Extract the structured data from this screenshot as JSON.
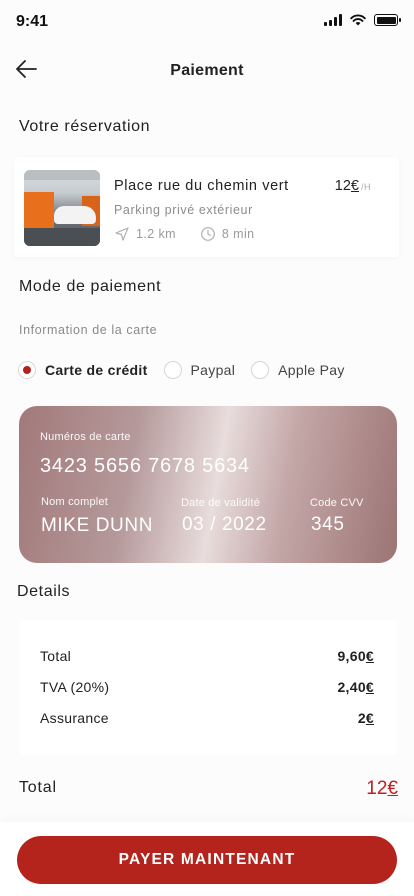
{
  "status": {
    "time": "9:41"
  },
  "header": {
    "title": "Paiement",
    "back_icon": "arrow-left-icon"
  },
  "reservation": {
    "section_title": "Votre réservation",
    "name": "Place rue du chemin vert",
    "price": "12",
    "currency": "€",
    "unit": "/H",
    "subtitle": "Parking privé extérieur",
    "distance": "1.2 km",
    "duration": "8 min"
  },
  "payment": {
    "section_title": "Mode de paiement",
    "card_info_label": "Information de la carte",
    "options": [
      {
        "label": "Carte de crédit",
        "selected": true
      },
      {
        "label": "Paypal",
        "selected": false
      },
      {
        "label": "Apple Pay",
        "selected": false
      }
    ]
  },
  "card": {
    "number_label": "Numéros de carte",
    "number": "3423 5656 7678 5634",
    "name_label": "Nom complet",
    "name": "MIKE DUNN",
    "expiry_label": "Date de validité",
    "expiry": "03 / 2022",
    "cvv_label": "Code CVV",
    "cvv": "345"
  },
  "details": {
    "section_title": "Details",
    "rows": [
      {
        "label": "Total",
        "amount": "9,60",
        "currency": "€"
      },
      {
        "label": "TVA (20%)",
        "amount": "2,40",
        "currency": "€"
      },
      {
        "label": "Assurance",
        "amount": "2",
        "currency": "€"
      }
    ]
  },
  "total": {
    "label": "Total",
    "amount": "12",
    "currency": "€"
  },
  "cta": {
    "label": "PAYER MAINTENANT"
  },
  "colors": {
    "accent": "#b5241c",
    "total_red": "#c0211f"
  }
}
